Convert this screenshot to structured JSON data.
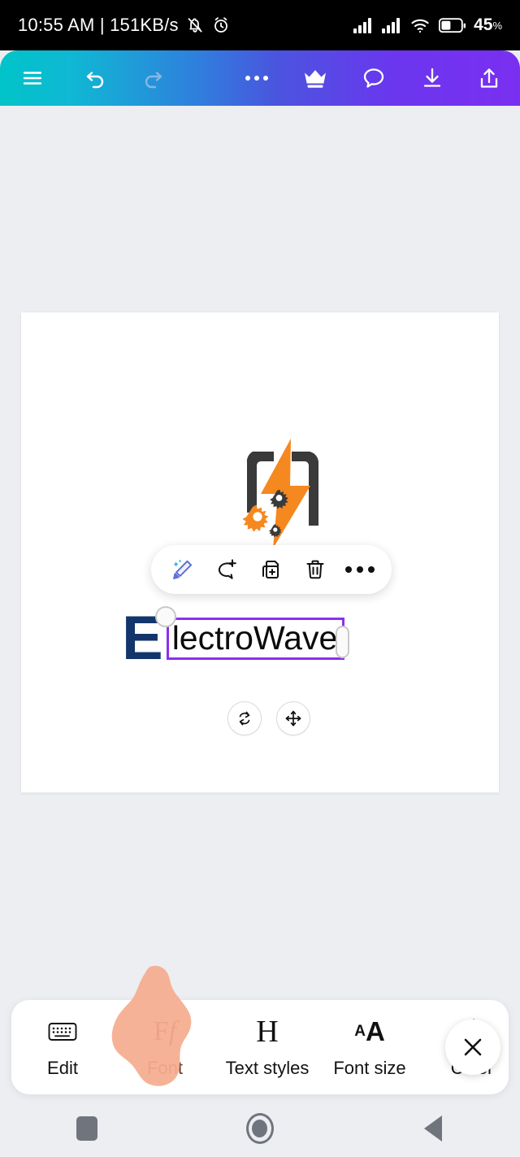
{
  "status_bar": {
    "time": "10:55 AM",
    "separator": "|",
    "network_speed": "151KB/s",
    "time_full": "10:55 AM | 151KB/s",
    "icons_left": [
      "silent-bell-icon",
      "alarm-clock-icon"
    ],
    "icons_right": [
      "signal-bars-icon",
      "signal-bars-icon",
      "wifi-icon",
      "battery-icon"
    ],
    "battery_percent": "45",
    "battery_percent_symbol": "%",
    "battery_level": 45
  },
  "app_toolbar": {
    "gradient_start": "#00c4c8",
    "gradient_end": "#7b2ff0",
    "items": [
      {
        "name": "menu-icon",
        "label": "Menu"
      },
      {
        "name": "undo-icon",
        "label": "Undo"
      },
      {
        "name": "redo-icon",
        "label": "Redo",
        "disabled": true
      },
      {
        "name": "more-icon",
        "label": "More"
      },
      {
        "name": "crown-icon",
        "label": "Premium"
      },
      {
        "name": "comment-icon",
        "label": "Comments"
      },
      {
        "name": "download-icon",
        "label": "Download"
      },
      {
        "name": "share-icon",
        "label": "Share"
      }
    ]
  },
  "canvas": {
    "background": "#ffffff",
    "logo": {
      "name": "electrowave-logo-mark",
      "bolt_color": "#f5881f",
      "frame_color": "#3a3a3a",
      "gear_colors": [
        "#f5881f",
        "#3a3a3a"
      ]
    },
    "brand": {
      "initial": "E",
      "initial_color": "#12366b",
      "text_value": "lectroWave",
      "text_color": "#0b0b0b",
      "full_name": "ElectroWave"
    },
    "selection": {
      "border_color": "#8c2ff0",
      "handles": [
        "rotate-handle-circle",
        "resize-handle-pill"
      ]
    },
    "transform_buttons": [
      {
        "name": "rotate-button",
        "label": "Rotate"
      },
      {
        "name": "move-button",
        "label": "Move"
      }
    ]
  },
  "context_toolbar": {
    "items": [
      {
        "name": "ai-magic-edit-icon",
        "label": "AI edit"
      },
      {
        "name": "add-comment-icon",
        "label": "Comment"
      },
      {
        "name": "duplicate-icon",
        "label": "Duplicate"
      },
      {
        "name": "delete-icon",
        "label": "Delete"
      },
      {
        "name": "more-options-icon",
        "label": "More"
      }
    ]
  },
  "bottom_bar": {
    "items": [
      {
        "icon": "keyboard-icon",
        "label": "Edit",
        "glyph": "",
        "active": false
      },
      {
        "icon": "font-icon",
        "label": "Font",
        "glyph": "Ff",
        "active": true
      },
      {
        "icon": "text-styles-icon",
        "label": "Text styles",
        "glyph": "H",
        "active": false
      },
      {
        "icon": "font-size-icon",
        "label": "Font size",
        "glyph": "aA",
        "active": false
      },
      {
        "icon": "color-brush-icon",
        "label": "Color",
        "glyph": "",
        "active": false
      }
    ],
    "close_label": "Close",
    "highlight_color": "#f5ac8f",
    "highlight_target": "Font"
  },
  "nav_bar": {
    "items": [
      {
        "name": "recents-button",
        "label": "Recents"
      },
      {
        "name": "home-button",
        "label": "Home"
      },
      {
        "name": "back-button",
        "label": "Back"
      }
    ]
  }
}
